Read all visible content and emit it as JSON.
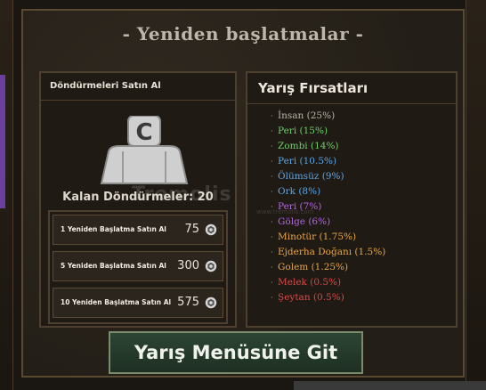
{
  "title": "- Yeniden başlatmalar -",
  "shop": {
    "heading": "Döndürmeleri Satın Al",
    "remaining_text": "Kalan Döndürmeler: 20",
    "avatar_letter": "C",
    "options": [
      {
        "label": "1 Yeniden Başlatma Satın Al",
        "price": "75"
      },
      {
        "label": "5 Yeniden Başlatma Satın Al",
        "price": "300"
      },
      {
        "label": "10 Yeniden Başlatma Satın Al",
        "price": "575"
      }
    ]
  },
  "chances": {
    "heading": "Yarış Fırsatları",
    "races": [
      {
        "text": "İnsan (25%)",
        "color": "#b9b3a8"
      },
      {
        "text": "Peri (15%)",
        "color": "#6fcf6a"
      },
      {
        "text": "Zombi (14%)",
        "color": "#6fcf6a"
      },
      {
        "text": "Peri (10.5%)",
        "color": "#5aa6e8"
      },
      {
        "text": "Ölümsüz (9%)",
        "color": "#5aa6e8"
      },
      {
        "text": "Ork (8%)",
        "color": "#5aa6e8"
      },
      {
        "text": "Peri (7%)",
        "color": "#b565e8"
      },
      {
        "text": "Gölge (6%)",
        "color": "#b565e8"
      },
      {
        "text": "Minotür (1.75%)",
        "color": "#e8a640"
      },
      {
        "text": "Ejderha Doğanı (1.5%)",
        "color": "#e8a640"
      },
      {
        "text": "Golem (1.25%)",
        "color": "#e8a640"
      },
      {
        "text": "Melek (0.5%)",
        "color": "#e04848"
      },
      {
        "text": "Şeytan (0.5%)",
        "color": "#e04848"
      }
    ]
  },
  "go_button": "Yarış Menüsüne Git",
  "watermark": {
    "main": "Tremolis",
    "sub": "www.tremolis.com"
  },
  "icons": {
    "currency": "coin-icon",
    "avatar": "character-silhouette-icon"
  }
}
